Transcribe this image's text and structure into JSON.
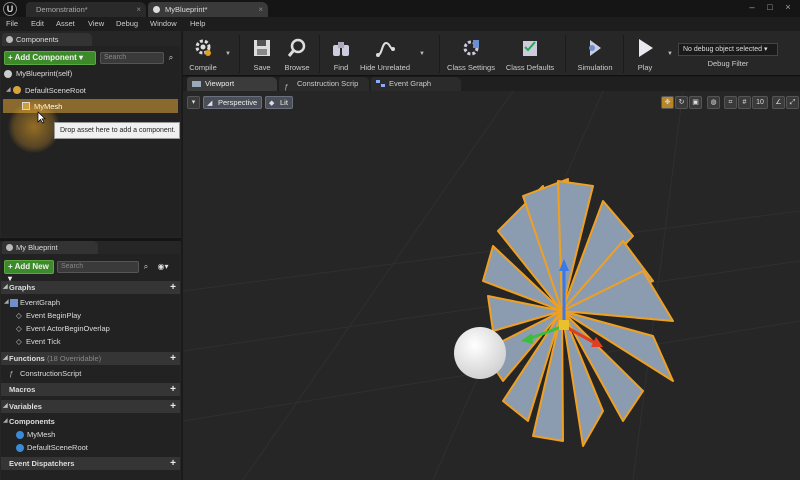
{
  "titlebar": {
    "tabs": [
      {
        "label": "Demonstration*"
      },
      {
        "label": "MyBlueprint*"
      }
    ]
  },
  "menubar": {
    "items": [
      "File",
      "Edit",
      "Asset",
      "View",
      "Debug",
      "Window",
      "Help"
    ]
  },
  "components_panel": {
    "tab_label": "Components",
    "add_button": "+ Add Component ▾",
    "search_placeholder": "Search",
    "self_label": "MyBlueprint(self)",
    "tree": [
      {
        "label": "DefaultSceneRoot"
      },
      {
        "label": "MyMesh"
      }
    ],
    "tooltip": "Drop asset here to add a component."
  },
  "my_blueprint_panel": {
    "tab_label": "My Blueprint",
    "add_button": "+ Add New ▾",
    "search_placeholder": "Search",
    "graphs": {
      "title": "Graphs",
      "items": [
        "EventGraph",
        "Event BeginPlay",
        "Event ActorBeginOverlap",
        "Event Tick"
      ]
    },
    "functions": {
      "title": "Functions",
      "sub": "(18 Overridable)",
      "items": [
        "ConstructionScript"
      ]
    },
    "macros": {
      "title": "Macros"
    },
    "variables": {
      "title": "Variables",
      "group": "Components",
      "items": [
        "MyMesh",
        "DefaultSceneRoot"
      ]
    },
    "event_dispatchers": {
      "title": "Event Dispatchers"
    }
  },
  "toolbar": {
    "compile": "Compile",
    "save": "Save",
    "browse": "Browse",
    "find": "Find",
    "hide_unrelated": "Hide Unrelated",
    "class_settings": "Class Settings",
    "class_defaults": "Class Defaults",
    "simulation": "Simulation",
    "play": "Play",
    "debug_select": "No debug object selected ▾",
    "debug_filter": "Debug Filter"
  },
  "editor_tabs": [
    {
      "label": "Viewport"
    },
    {
      "label": "Construction Scrip"
    },
    {
      "label": "Event Graph"
    }
  ],
  "viewport": {
    "perspective": "Perspective",
    "lit": "Lit",
    "snap_value": "10"
  },
  "colors": {
    "selection_orange": "#f0a020",
    "add_green": "#3d8a2a",
    "fan_blade": "#8c9cb0"
  }
}
